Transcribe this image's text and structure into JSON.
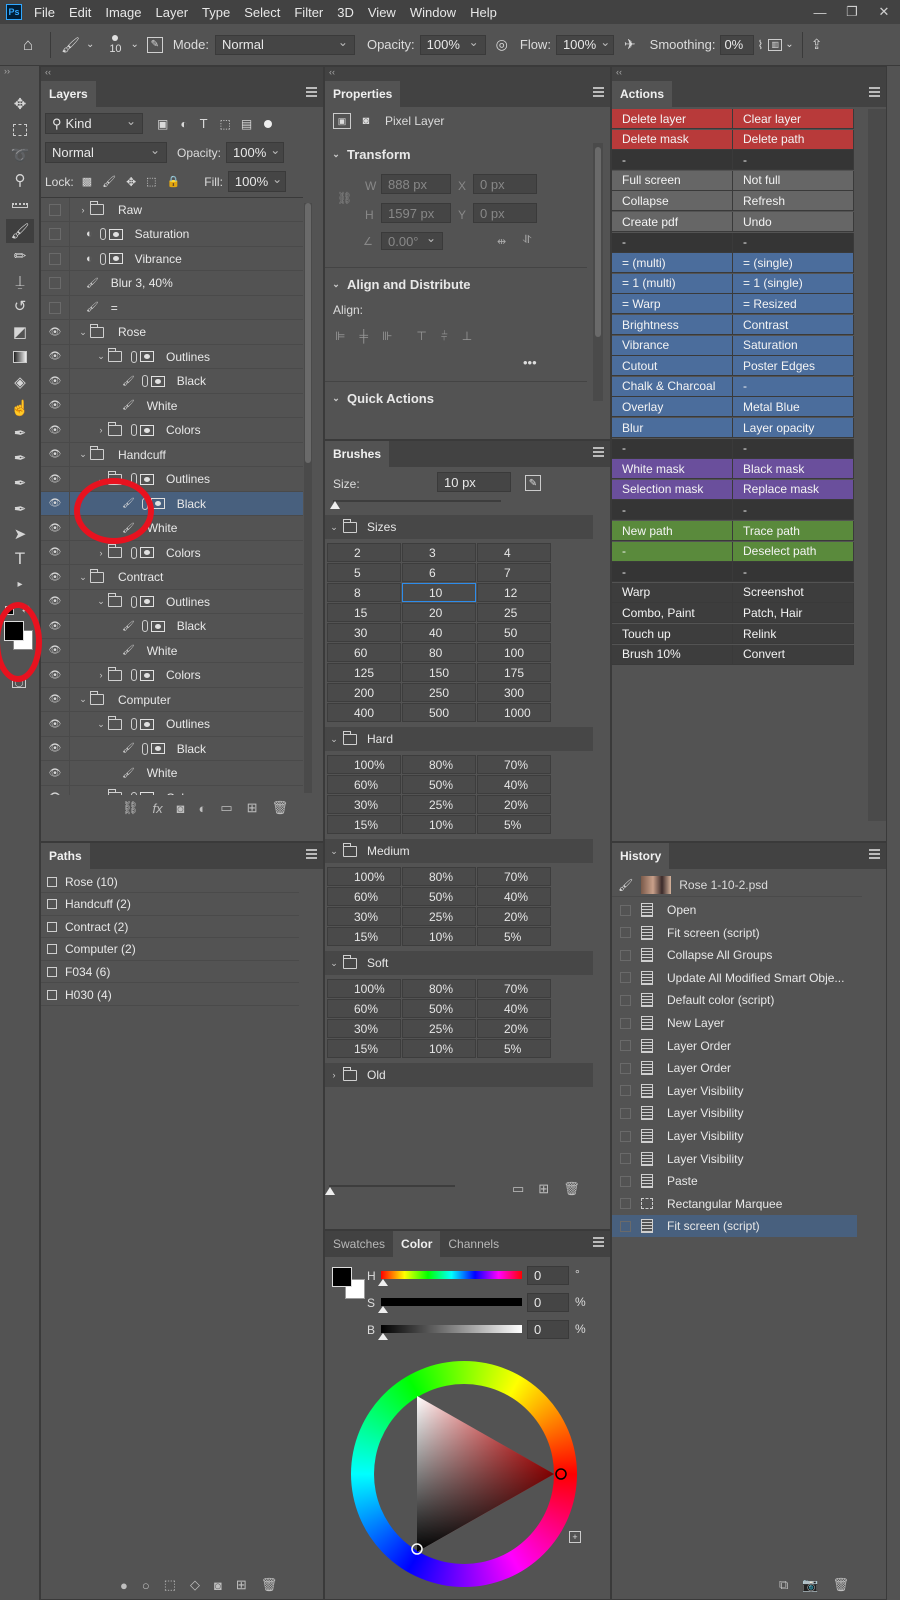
{
  "menubar": {
    "logo": "Ps",
    "items": [
      "File",
      "Edit",
      "Image",
      "Layer",
      "Type",
      "Select",
      "Filter",
      "3D",
      "View",
      "Window",
      "Help"
    ],
    "window_controls": [
      "—",
      "❐",
      "✕"
    ]
  },
  "options": {
    "brush_size": "10",
    "mode_label": "Mode:",
    "mode_value": "Normal",
    "opacity_label": "Opacity:",
    "opacity_value": "100%",
    "flow_label": "Flow:",
    "flow_value": "100%",
    "smoothing_label": "Smoothing:",
    "smoothing_value": "0%"
  },
  "layers_panel": {
    "title": "Layers",
    "filter_kind": "Kind",
    "blend_mode": "Normal",
    "opacity_label": "Opacity:",
    "opacity_value": "100%",
    "lock_label": "Lock:",
    "fill_label": "Fill:",
    "fill_value": "100%",
    "rows": [
      {
        "label": "Raw",
        "type": "group",
        "indent": 0,
        "eye": false,
        "collapsed": true
      },
      {
        "label": "Saturation",
        "type": "adjust",
        "indent": 0,
        "eye": false
      },
      {
        "label": "Vibrance",
        "type": "adjust",
        "indent": 0,
        "eye": false
      },
      {
        "label": "Blur 3, 40%",
        "type": "brush",
        "indent": 0,
        "eye": false
      },
      {
        "label": "=",
        "type": "brush",
        "indent": 0,
        "eye": false
      },
      {
        "label": "Rose",
        "type": "group",
        "indent": 0,
        "eye": true,
        "collapsed": false
      },
      {
        "label": "Outlines",
        "type": "groupmask",
        "indent": 1,
        "eye": true,
        "collapsed": false
      },
      {
        "label": "Black",
        "type": "brushmask",
        "indent": 2,
        "eye": true
      },
      {
        "label": "White",
        "type": "brush",
        "indent": 2,
        "eye": true
      },
      {
        "label": "Colors",
        "type": "groupmask",
        "indent": 1,
        "eye": true,
        "collapsed": true
      },
      {
        "label": "Handcuff",
        "type": "group",
        "indent": 0,
        "eye": true,
        "collapsed": false
      },
      {
        "label": "Outlines",
        "type": "groupmask",
        "indent": 1,
        "eye": true,
        "collapsed": false
      },
      {
        "label": "Black",
        "type": "brushmask",
        "indent": 2,
        "eye": true,
        "selected": true
      },
      {
        "label": "White",
        "type": "brush",
        "indent": 2,
        "eye": true
      },
      {
        "label": "Colors",
        "type": "groupmask",
        "indent": 1,
        "eye": true,
        "collapsed": true
      },
      {
        "label": "Contract",
        "type": "group",
        "indent": 0,
        "eye": true,
        "collapsed": false
      },
      {
        "label": "Outlines",
        "type": "groupmask",
        "indent": 1,
        "eye": true,
        "collapsed": false
      },
      {
        "label": "Black",
        "type": "brushmask",
        "indent": 2,
        "eye": true
      },
      {
        "label": "White",
        "type": "brush",
        "indent": 2,
        "eye": true
      },
      {
        "label": "Colors",
        "type": "groupmask",
        "indent": 1,
        "eye": true,
        "collapsed": true
      },
      {
        "label": "Computer",
        "type": "group",
        "indent": 0,
        "eye": true,
        "collapsed": false
      },
      {
        "label": "Outlines",
        "type": "groupmask",
        "indent": 1,
        "eye": true,
        "collapsed": false
      },
      {
        "label": "Black",
        "type": "brushmask",
        "indent": 2,
        "eye": true
      },
      {
        "label": "White",
        "type": "brush",
        "indent": 2,
        "eye": true
      },
      {
        "label": "Colors",
        "type": "groupmask",
        "indent": 1,
        "eye": true,
        "collapsed": true
      }
    ]
  },
  "paths_panel": {
    "title": "Paths",
    "items": [
      "Rose (10)",
      "Handcuff (2)",
      "Contract (2)",
      "Computer (2)",
      "F034 (6)",
      "H030 (4)"
    ]
  },
  "properties_panel": {
    "title": "Properties",
    "layer_kind": "Pixel Layer",
    "transform_title": "Transform",
    "w_label": "W",
    "w_value": "888 px",
    "h_label": "H",
    "h_value": "1597 px",
    "x_label": "X",
    "x_value": "0 px",
    "y_label": "Y",
    "y_value": "0 px",
    "angle_value": "0.00°",
    "align_title": "Align and Distribute",
    "align_label": "Align:",
    "quick_actions_title": "Quick Actions"
  },
  "brushes_panel": {
    "title": "Brushes",
    "size_label": "Size:",
    "size_value": "10 px",
    "groups": [
      {
        "name": "Sizes",
        "open": true,
        "cells": [
          "2",
          "3",
          "4",
          "5",
          "6",
          "7",
          "8",
          "10",
          "12",
          "15",
          "20",
          "25",
          "30",
          "40",
          "50",
          "60",
          "80",
          "100",
          "125",
          "150",
          "175",
          "200",
          "250",
          "300",
          "400",
          "500",
          "1000"
        ],
        "selected": "10"
      },
      {
        "name": "Hard",
        "open": true,
        "cells": [
          "100%",
          "80%",
          "70%",
          "60%",
          "50%",
          "40%",
          "30%",
          "25%",
          "20%",
          "15%",
          "10%",
          "5%"
        ]
      },
      {
        "name": "Medium",
        "open": true,
        "cells": [
          "100%",
          "80%",
          "70%",
          "60%",
          "50%",
          "40%",
          "30%",
          "25%",
          "20%",
          "15%",
          "10%",
          "5%"
        ]
      },
      {
        "name": "Soft",
        "open": true,
        "cells": [
          "100%",
          "80%",
          "70%",
          "60%",
          "50%",
          "40%",
          "30%",
          "25%",
          "20%",
          "15%",
          "10%",
          "5%"
        ]
      },
      {
        "name": "Old",
        "open": false,
        "cells": []
      }
    ]
  },
  "color_panel": {
    "tabs": [
      "Swatches",
      "Color",
      "Channels"
    ],
    "active_tab": "Color",
    "h_label": "H",
    "h_value": "0",
    "h_unit": "°",
    "s_label": "S",
    "s_value": "0",
    "s_unit": "%",
    "b_label": "B",
    "b_value": "0",
    "b_unit": "%",
    "foreground": "#000000",
    "background": "#ffffff"
  },
  "actions_panel": {
    "title": "Actions",
    "colors": {
      "red": "#b83a3a",
      "gray": "#666666",
      "blue": "#4b6d9c",
      "purple": "#6a4f9c",
      "green": "#5a8a3c",
      "none": "#3d3d3d",
      "dark": "#353535"
    },
    "rows": [
      {
        "left": "Delete layer",
        "right": "Clear layer",
        "color": "red"
      },
      {
        "left": "Delete mask",
        "right": "Delete path",
        "color": "red"
      },
      {
        "left": "-",
        "right": "-",
        "color": "dark"
      },
      {
        "left": "Full screen",
        "right": "Not full",
        "color": "gray"
      },
      {
        "left": "Collapse",
        "right": "Refresh",
        "color": "gray"
      },
      {
        "left": "Create pdf",
        "right": "Undo",
        "color": "gray"
      },
      {
        "left": "-",
        "right": "-",
        "color": "dark"
      },
      {
        "left": "= (multi)",
        "right": "= (single)",
        "color": "blue"
      },
      {
        "left": "= 1 (multi)",
        "right": "= 1 (single)",
        "color": "blue"
      },
      {
        "left": "= Warp",
        "right": "= Resized",
        "color": "blue"
      },
      {
        "left": "Brightness",
        "right": "Contrast",
        "color": "blue"
      },
      {
        "left": "Vibrance",
        "right": "Saturation",
        "color": "blue"
      },
      {
        "left": "Cutout",
        "right": "Poster Edges",
        "color": "blue"
      },
      {
        "left": "Chalk & Charcoal",
        "right": "-",
        "color": "blue"
      },
      {
        "left": "Overlay",
        "right": "Metal Blue",
        "color": "blue"
      },
      {
        "left": "Blur",
        "right": "Layer opacity",
        "color": "blue"
      },
      {
        "left": "-",
        "right": "-",
        "color": "dark"
      },
      {
        "left": "White mask",
        "right": "Black mask",
        "color": "purple"
      },
      {
        "left": "Selection mask",
        "right": "Replace mask",
        "color": "purple"
      },
      {
        "left": "-",
        "right": "-",
        "color": "dark"
      },
      {
        "left": "New path",
        "right": "Trace path",
        "color": "green"
      },
      {
        "left": "-",
        "right": "Deselect path",
        "color": "green"
      },
      {
        "left": "-",
        "right": "-",
        "color": "dark"
      },
      {
        "left": "Warp",
        "right": "Screenshot",
        "color": "none"
      },
      {
        "left": "Combo, Paint",
        "right": "Patch, Hair",
        "color": "none"
      },
      {
        "left": "Touch up",
        "right": "Relink",
        "color": "none"
      },
      {
        "left": "Brush 10%",
        "right": "Convert",
        "color": "none"
      }
    ]
  },
  "history_panel": {
    "title": "History",
    "document": "Rose 1-10-2.psd",
    "items": [
      "Open",
      "Fit screen (script)",
      "Collapse All Groups",
      "Update All Modified Smart Obje...",
      "Default color (script)",
      "New Layer",
      "Layer Order",
      "Layer Order",
      "Layer Visibility",
      "Layer Visibility",
      "Layer Visibility",
      "Layer Visibility",
      "Paste",
      "Rectangular Marquee",
      "Fit screen (script)"
    ],
    "selected_index": 14
  }
}
